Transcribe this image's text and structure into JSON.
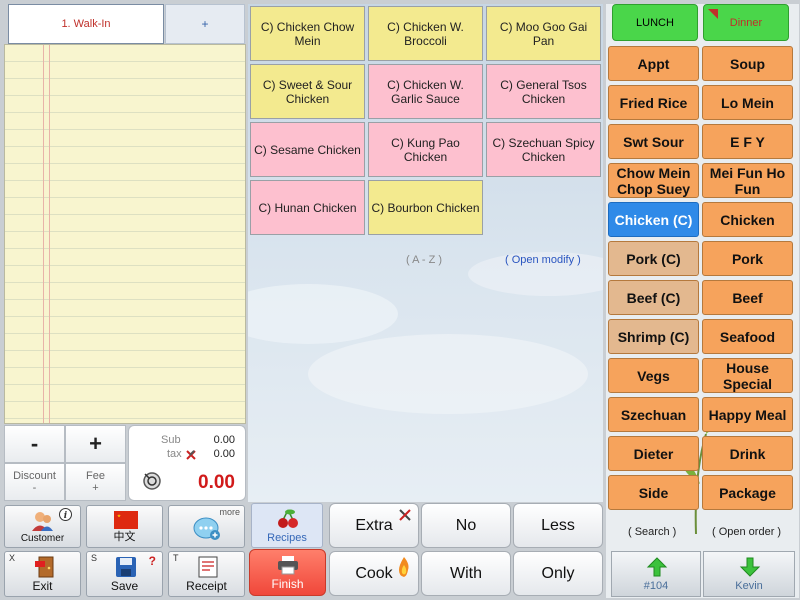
{
  "order": {
    "tab_label": "1. Walk-In",
    "add_tab_label": "+",
    "minus_label": "-",
    "plus_label": "+",
    "discount_label": "Discount",
    "discount_value": "-",
    "fee_label": "Fee",
    "fee_value": "+",
    "sub_label": "Sub",
    "sub_value": "0.00",
    "tax_label": "tax",
    "tax_value": "0.00",
    "total_value": "0.00"
  },
  "tools": {
    "customer_label": "Customer",
    "language_label": "中文",
    "more_label": "more",
    "exit_letter": "X",
    "exit_label": "Exit",
    "save_letter": "S",
    "save_label": "Save",
    "receipt_letter": "T",
    "receipt_label": "Receipt"
  },
  "menu_items": [
    {
      "label": "C) Chicken Chow Mein",
      "color": "yellow"
    },
    {
      "label": "C) Chicken W. Broccoli",
      "color": "yellow"
    },
    {
      "label": "C) Moo Goo Gai Pan",
      "color": "yellow"
    },
    {
      "label": "C) Sweet & Sour Chicken",
      "color": "yellow"
    },
    {
      "label": "C) Chicken W. Garlic Sauce",
      "color": "pink"
    },
    {
      "label": "C) General Tsos Chicken",
      "color": "pink"
    },
    {
      "label": "C) Sesame Chicken",
      "color": "pink"
    },
    {
      "label": "C) Kung Pao Chicken",
      "color": "pink"
    },
    {
      "label": "C) Szechuan Spicy Chicken",
      "color": "pink"
    },
    {
      "label": "C) Hunan Chicken",
      "color": "pink"
    },
    {
      "label": "C) Bourbon Chicken",
      "color": "yellow"
    }
  ],
  "menu_footer": {
    "az_label": "( A - Z )",
    "open_modify_label": "( Open modify )"
  },
  "modifiers": {
    "recipes_label": "Recipes",
    "finish_label": "Finish",
    "extra_label": "Extra",
    "no_label": "No",
    "less_label": "Less",
    "cook_label": "Cook",
    "with_label": "With",
    "only_label": "Only"
  },
  "meal_tabs": {
    "lunch_label": "LUNCH",
    "dinner_label": "Dinner"
  },
  "categories": [
    {
      "label": "Appt",
      "style": "orange"
    },
    {
      "label": "Soup",
      "style": "orange"
    },
    {
      "label": "Fried Rice",
      "style": "orange"
    },
    {
      "label": "Lo Mein",
      "style": "orange"
    },
    {
      "label": "Swt Sour",
      "style": "orange"
    },
    {
      "label": "E F Y",
      "style": "orange"
    },
    {
      "label": "Chow Mein Chop Suey",
      "style": "orange"
    },
    {
      "label": "Mei Fun Ho Fun",
      "style": "orange"
    },
    {
      "label": "Chicken (C)",
      "style": "blue"
    },
    {
      "label": "Chicken",
      "style": "orange"
    },
    {
      "label": "Pork (C)",
      "style": "tan"
    },
    {
      "label": "Pork",
      "style": "orange"
    },
    {
      "label": "Beef (C)",
      "style": "tan"
    },
    {
      "label": "Beef",
      "style": "orange"
    },
    {
      "label": "Shrimp (C)",
      "style": "tan"
    },
    {
      "label": "Seafood",
      "style": "orange"
    },
    {
      "label": "Vegs",
      "style": "orange"
    },
    {
      "label": "House Special",
      "style": "orange"
    },
    {
      "label": "Szechuan",
      "style": "orange"
    },
    {
      "label": "Happy Meal",
      "style": "orange"
    },
    {
      "label": "Dieter",
      "style": "orange"
    },
    {
      "label": "Drink",
      "style": "orange"
    },
    {
      "label": "Side",
      "style": "orange"
    },
    {
      "label": "Package",
      "style": "orange"
    }
  ],
  "right_footer": {
    "search_label": "( Search )",
    "open_order_label": "( Open order )",
    "order_number_label": "#104",
    "user_label": "Kevin"
  },
  "colors": {
    "accent_blue": "#2f8ae8",
    "category_orange": "#f6a35c",
    "item_yellow": "#f3ea8f",
    "item_pink": "#fdc0cf",
    "finish_red": "#f0473a",
    "meal_green": "#4ad64a"
  }
}
